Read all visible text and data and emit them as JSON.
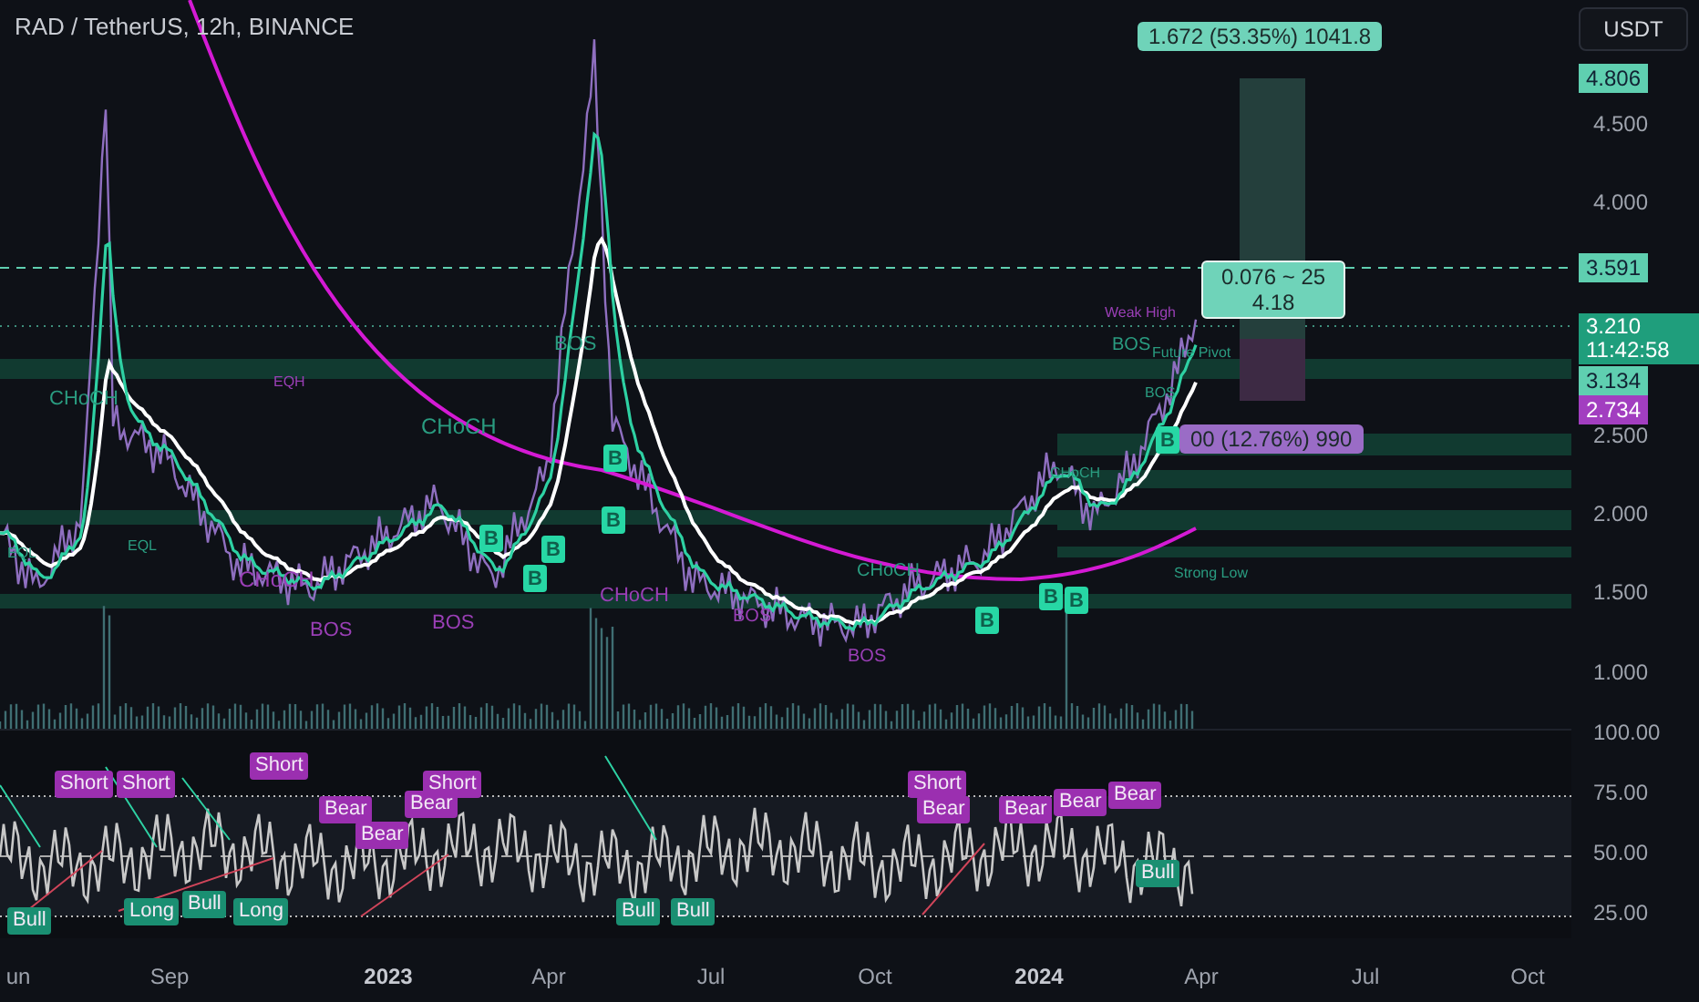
{
  "chart_title": "RAD / TetherUS, 12h, BINANCE",
  "currency_button": "USDT",
  "price_axis": {
    "ticks": [
      "4.500",
      "4.000",
      "2.500",
      "2.000",
      "1.500",
      "1.000"
    ],
    "badges": [
      {
        "text": "4.806",
        "color": "#5fcfb0"
      },
      {
        "text": "3.591",
        "color": "#5fcfb0"
      },
      {
        "text": "3.210",
        "subtext": "11:42:58",
        "color": "#1f9e7c"
      },
      {
        "text": "3.134",
        "color": "#5fcfb0"
      },
      {
        "text": "2.734",
        "color": "#a23ec0"
      }
    ]
  },
  "measure_boxes": [
    {
      "lines": [
        "1.672 (53.35%) 1041.8"
      ],
      "color": "#6fd3b9"
    },
    {
      "lines": [
        "0.076 ~ 25",
        "4.18"
      ],
      "color": "#6fd3b9"
    },
    {
      "lines": [
        "00 (12.76%) 990"
      ],
      "color": "#9a6cc6"
    }
  ],
  "structure_labels": [
    {
      "text": "CHoCH",
      "color": "#2a9c80"
    },
    {
      "text": "CHoCH",
      "color": "#2a9c80"
    },
    {
      "text": "BOS",
      "color": "#2a9c80"
    },
    {
      "text": "CHoCH",
      "color": "#9a3fb6"
    },
    {
      "text": "BOS",
      "color": "#9a3fb6"
    },
    {
      "text": "BOS",
      "color": "#9a3fb6"
    },
    {
      "text": "CHoCH",
      "color": "#9a3fb6"
    },
    {
      "text": "BOS",
      "color": "#9a3fb6"
    },
    {
      "text": "BOS",
      "color": "#9a3fb6"
    },
    {
      "text": "CHoCH",
      "color": "#2a9c80"
    },
    {
      "text": "BOS",
      "color": "#2a9c80"
    },
    {
      "text": "Future Pivot",
      "color": "#2a9c80"
    },
    {
      "text": "Weak High",
      "color": "#9a3fb6"
    },
    {
      "text": "Strong Low",
      "color": "#2a9c80"
    },
    {
      "text": "EQL",
      "color": "#2a9c80"
    },
    {
      "text": "EQH",
      "color": "#9a3fb6"
    },
    {
      "text": "EQL",
      "color": "#2a9c80"
    },
    {
      "text": "CHoCH",
      "color": "#2a9c80"
    },
    {
      "text": "BOS",
      "color": "#2a9c80"
    }
  ],
  "buy_markers": [
    "B",
    "B",
    "B",
    "B",
    "B",
    "B",
    "B",
    "B",
    "B"
  ],
  "rsi_axis": {
    "ticks": [
      "100.00",
      "75.00",
      "50.00",
      "25.00"
    ]
  },
  "rsi_signals": [
    {
      "text": "Short",
      "color": "#9b2fb0"
    },
    {
      "text": "Short",
      "color": "#9b2fb0"
    },
    {
      "text": "Short",
      "color": "#9b2fb0"
    },
    {
      "text": "Bear",
      "color": "#9b2fb0"
    },
    {
      "text": "Bear",
      "color": "#9b2fb0"
    },
    {
      "text": "Bear",
      "color": "#9b2fb0"
    },
    {
      "text": "Short",
      "color": "#9b2fb0"
    },
    {
      "text": "Short",
      "color": "#9b2fb0"
    },
    {
      "text": "Bear",
      "color": "#9b2fb0"
    },
    {
      "text": "Bear",
      "color": "#9b2fb0"
    },
    {
      "text": "Bear",
      "color": "#9b2fb0"
    },
    {
      "text": "Bear",
      "color": "#9b2fb0"
    },
    {
      "text": "Bull",
      "color": "#1a8f72"
    },
    {
      "text": "Long",
      "color": "#1a8f72"
    },
    {
      "text": "Bull",
      "color": "#1a8f72"
    },
    {
      "text": "Long",
      "color": "#1a8f72"
    },
    {
      "text": "Bull",
      "color": "#1a8f72"
    },
    {
      "text": "Bull",
      "color": "#1a8f72"
    },
    {
      "text": "Bull",
      "color": "#1a8f72"
    }
  ],
  "time_axis": [
    {
      "label": "un",
      "kind": "month"
    },
    {
      "label": "Sep",
      "kind": "month"
    },
    {
      "label": "2023",
      "kind": "year"
    },
    {
      "label": "Apr",
      "kind": "month"
    },
    {
      "label": "Jul",
      "kind": "month"
    },
    {
      "label": "Oct",
      "kind": "month"
    },
    {
      "label": "2024",
      "kind": "year"
    },
    {
      "label": "Apr",
      "kind": "month"
    },
    {
      "label": "Jul",
      "kind": "month"
    },
    {
      "label": "Oct",
      "kind": "month"
    }
  ]
}
